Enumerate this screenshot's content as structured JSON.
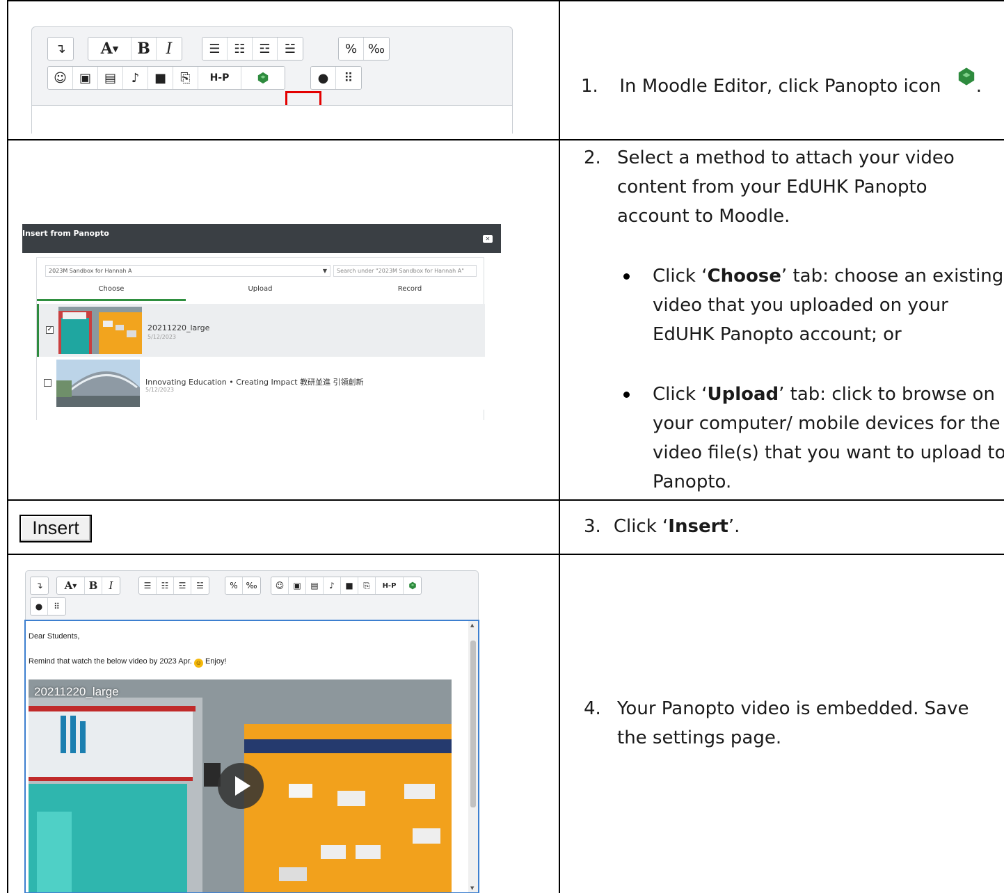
{
  "steps": [
    {
      "number": "1.",
      "text": "In Moodle Editor, click Panopto icon",
      "after_icon": "."
    },
    {
      "number": "2.",
      "lines": [
        "Select a method to attach your video",
        "content from your EdUHK Panopto",
        "account to Moodle."
      ],
      "bullets": [
        {
          "pre": "Click ‘",
          "bold": "Choose",
          "post": "’ tab: choose an existing",
          "lines": [
            "video that you uploaded on your",
            "EdUHK Panopto account; or"
          ]
        },
        {
          "pre": "Click ‘",
          "bold": "Upload",
          "post": "’ tab: click to browse on",
          "lines": [
            "your computer/ mobile devices for the",
            "video file(s) that you want to upload to",
            "Panopto."
          ]
        }
      ]
    },
    {
      "number": "3.",
      "pre": "Click ‘",
      "bold": "Insert",
      "post": "’."
    },
    {
      "number": "4.",
      "lines": [
        "Your Panopto video is embedded. Save",
        "the settings page."
      ]
    }
  ],
  "toolbar_icons": [
    "undo-icon",
    "font-size-icon",
    "bold-icon",
    "italic-icon",
    "unordered-list-icon",
    "ordered-list-icon",
    "outdent-icon",
    "indent-icon",
    "link-icon",
    "unlink-icon",
    "emoji-icon",
    "image-icon",
    "media-icon",
    "record-audio-icon",
    "record-video-icon",
    "manage-files-icon",
    "h5p-icon",
    "panopto-icon",
    "accessibility-checker-icon",
    "screenreader-helper-icon"
  ],
  "toolbar": {
    "font": "A",
    "bold": "B",
    "italic": "I",
    "h5p": "H-P"
  },
  "panopto_dialog": {
    "title": "Insert from Panopto",
    "folder": "2023M Sandbox for Hannah A",
    "search_placeholder": "Search under \"2023M Sandbox for Hannah A\"",
    "tabs": [
      "Choose",
      "Upload",
      "Record"
    ],
    "active_tab": "Choose",
    "videos": [
      {
        "title": "20211220_large",
        "date": "5/12/2023",
        "checked": true
      },
      {
        "title": "Innovating Education • Creating Impact 教研並進 引領創新",
        "date": "5/12/2023",
        "checked": false
      }
    ]
  },
  "insert_button": "Insert",
  "editor_content": {
    "line1": "Dear Students,",
    "line2_pre": "Remind that watch the below video by 2023 Apr.",
    "line2_post": "Enjoy!",
    "video_title": "20211220_large"
  },
  "colors": {
    "panopto_green": "#2e8b3e",
    "highlight_red": "#e30000",
    "dialog_header": "#3a3f44",
    "editor_focus": "#3d7fcf"
  }
}
